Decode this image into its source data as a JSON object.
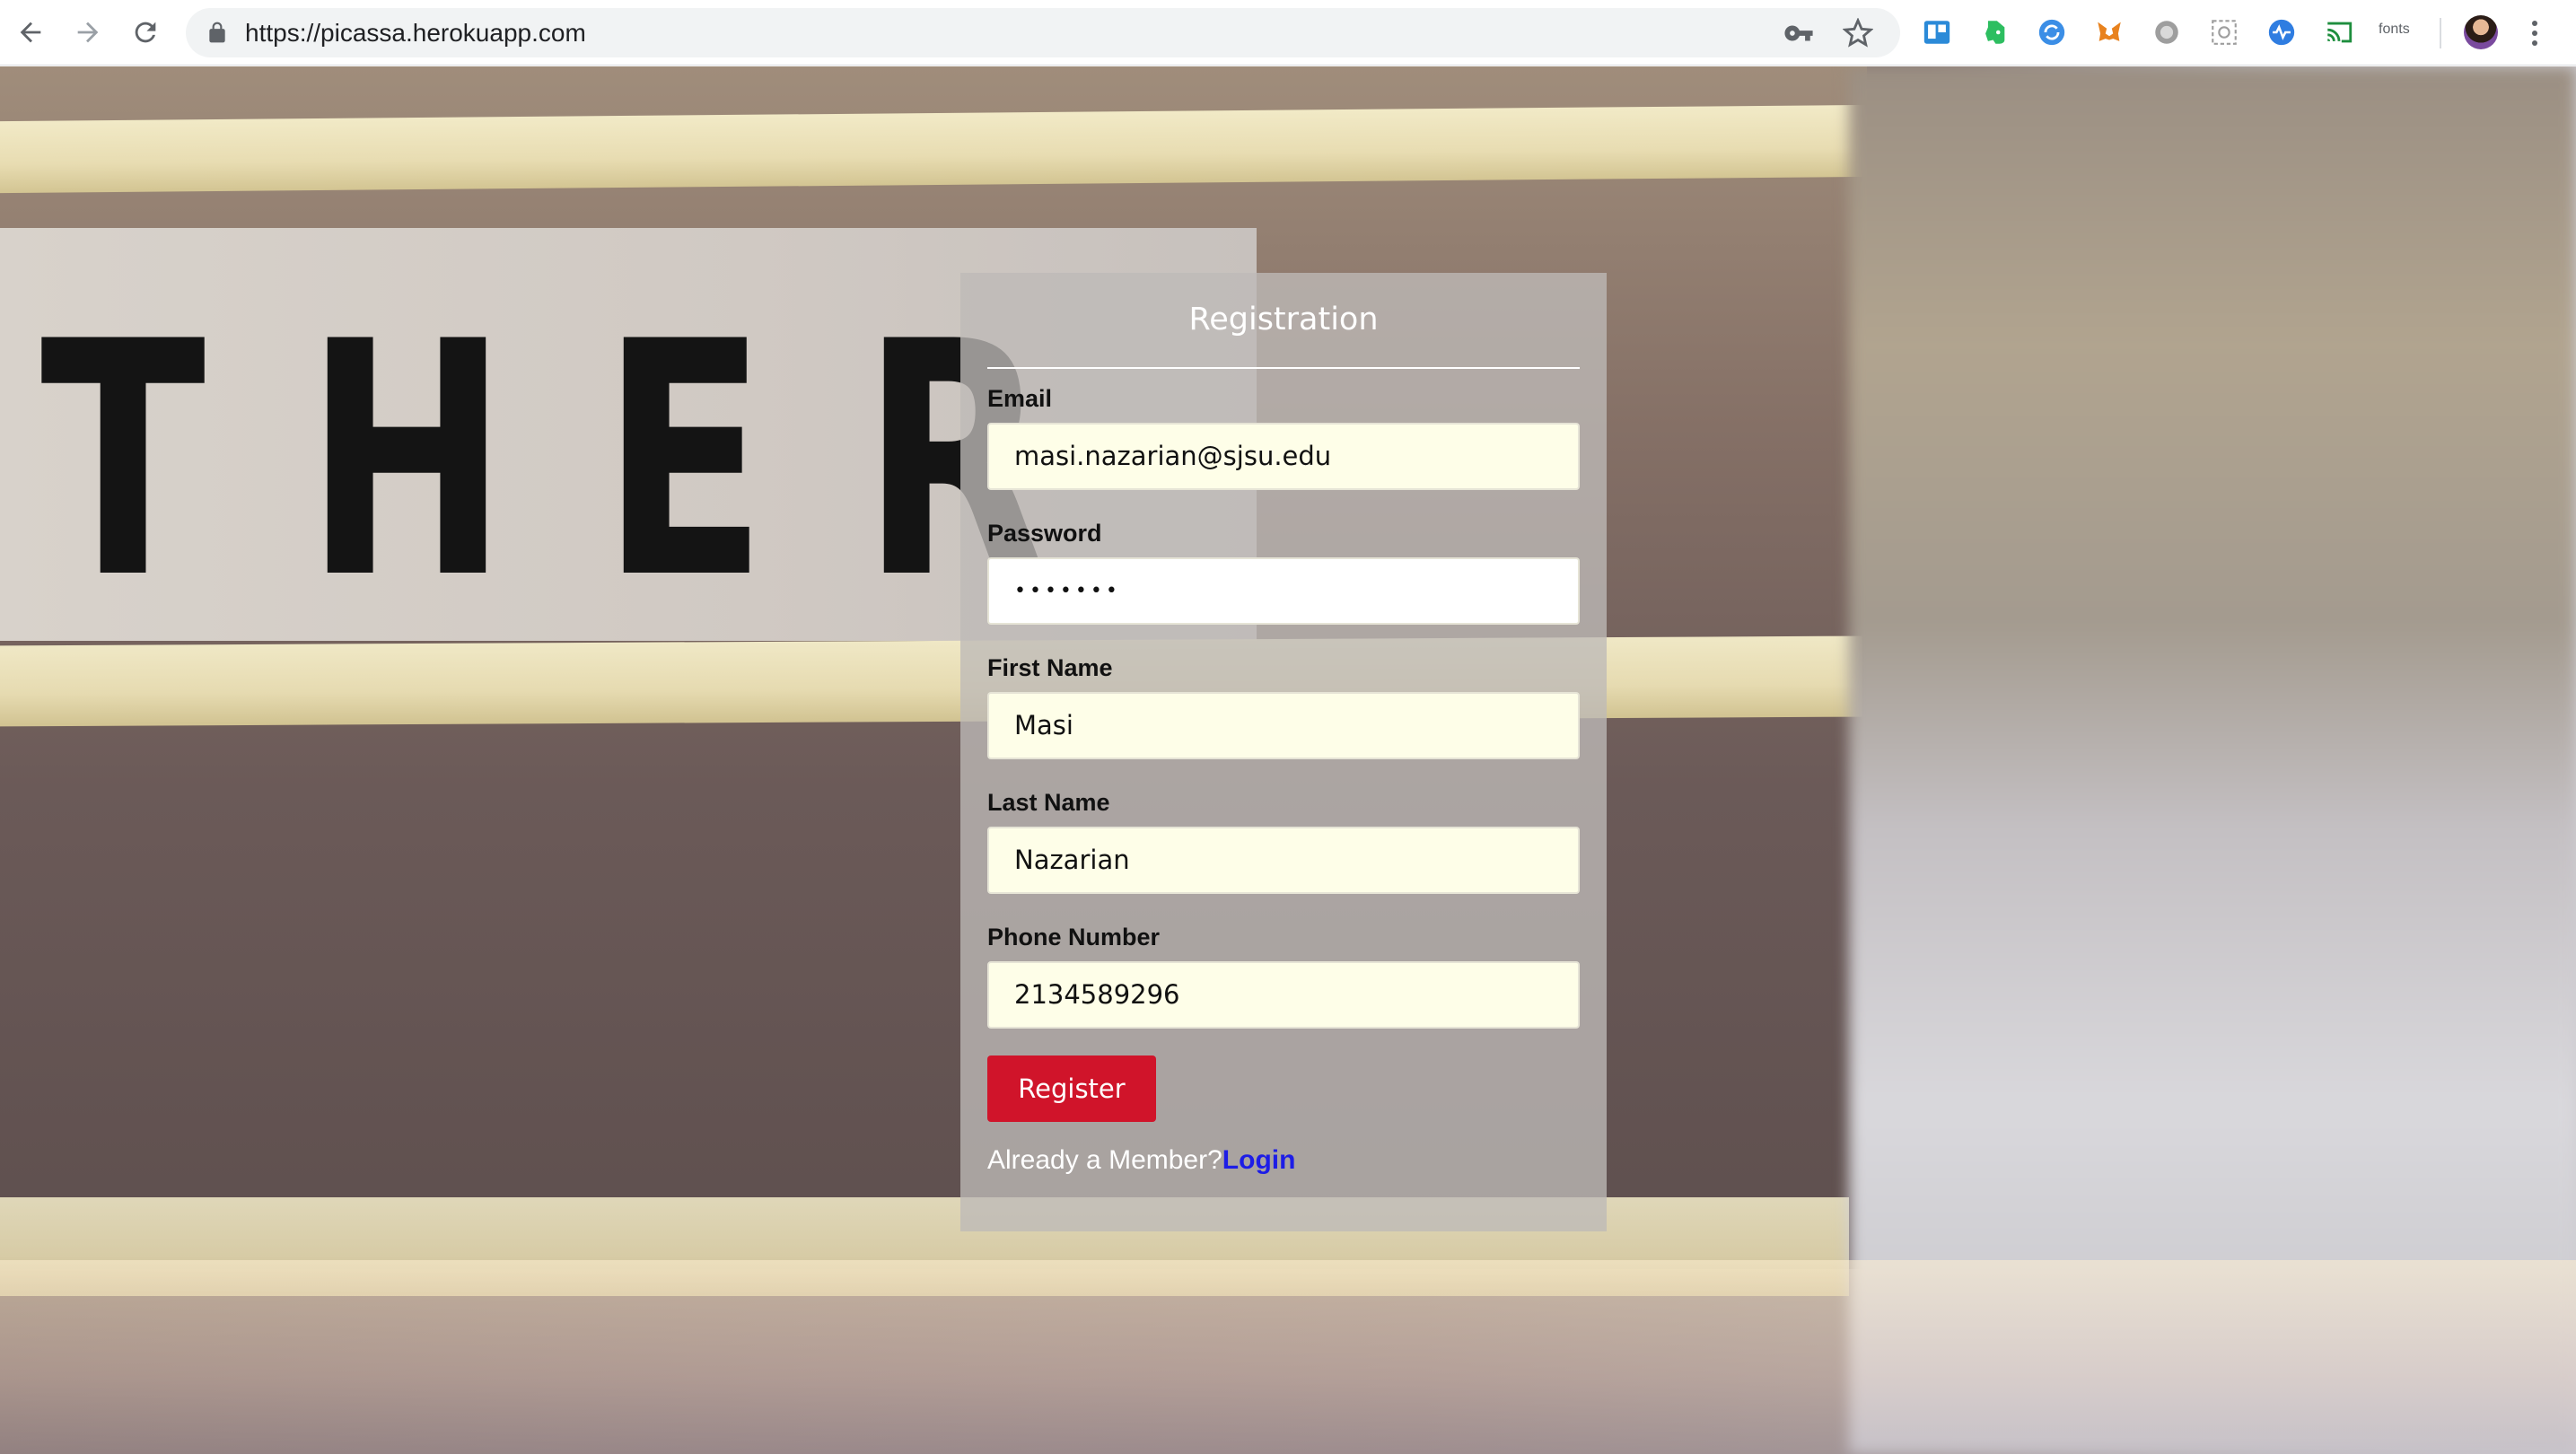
{
  "browser": {
    "url": "https://picassa.herokuapp.com",
    "extensions": [
      "trello-icon",
      "evernote-icon",
      "sync-icon",
      "metamask-icon",
      "circle-extension-icon",
      "placeholder-extension-icon",
      "pulse-icon",
      "cast-icon"
    ],
    "fonts_label": "fonts"
  },
  "background": {
    "letters": [
      "T",
      "H",
      "E",
      "R"
    ]
  },
  "form": {
    "title": "Registration",
    "fields": [
      {
        "label": "Email",
        "value": "masi.nazarian@sjsu.edu"
      },
      {
        "label": "Password",
        "value": "•••••••"
      },
      {
        "label": "First Name",
        "value": "Masi"
      },
      {
        "label": "Last Name",
        "value": "Nazarian"
      },
      {
        "label": "Phone Number",
        "value": "2134589296"
      }
    ],
    "register_label": "Register",
    "member_prompt": "Already a Member?",
    "login_label": "Login"
  },
  "colors": {
    "register_button": "#d0142a",
    "login_link": "#1d1de6",
    "input_autofill": "#fefee8"
  }
}
